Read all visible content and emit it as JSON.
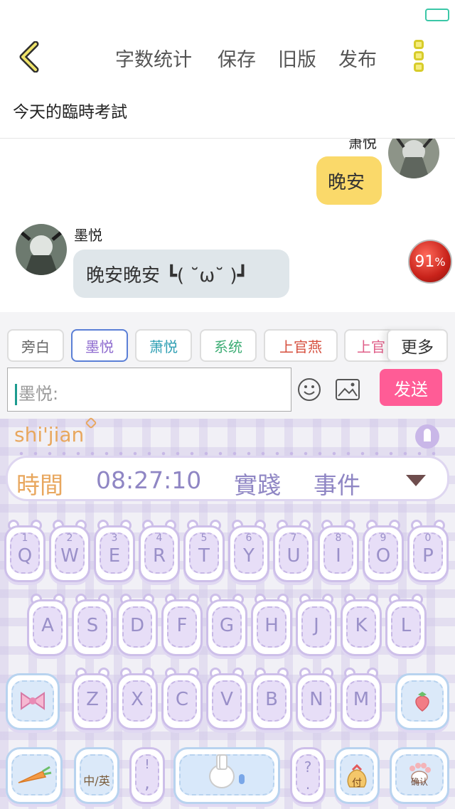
{
  "header": {
    "word_count": "字数统计",
    "save": "保存",
    "old_version": "旧版",
    "publish": "发布"
  },
  "document": {
    "title": "今天的臨時考試"
  },
  "chat": {
    "right_sender": "萧悦",
    "right_text": "晚安",
    "left_sender": "墨悦",
    "left_text": "晚安晚安 ┗( ˘ω˘ )┛",
    "badge_value": "91",
    "badge_unit": "%"
  },
  "roles": [
    "旁白",
    "墨悦",
    "萧悦",
    "系统",
    "上官燕",
    "上官"
  ],
  "role_more": "更多",
  "composer": {
    "prefix": "墨悦:",
    "send": "发送"
  },
  "keyboard": {
    "pinyin": "shi'jian",
    "candidates": [
      "時間",
      "08:27:10",
      "實踐",
      "事件"
    ],
    "row1": [
      {
        "num": "1",
        "letter": "Q"
      },
      {
        "num": "2",
        "letter": "W"
      },
      {
        "num": "3",
        "letter": "E"
      },
      {
        "num": "4",
        "letter": "R"
      },
      {
        "num": "5",
        "letter": "T"
      },
      {
        "num": "6",
        "letter": "Y"
      },
      {
        "num": "7",
        "letter": "U"
      },
      {
        "num": "8",
        "letter": "I"
      },
      {
        "num": "9",
        "letter": "O"
      },
      {
        "num": "0",
        "letter": "P"
      }
    ],
    "row2": [
      "A",
      "S",
      "D",
      "F",
      "G",
      "H",
      "J",
      "K",
      "L"
    ],
    "row3": [
      "Z",
      "X",
      "C",
      "V",
      "B",
      "N",
      "M"
    ],
    "lang_switch": "中/英",
    "punct": ",",
    "punct_top": "!",
    "question": "?",
    "question_bottom": ".",
    "pay": "付",
    "confirm": "确认"
  },
  "colors": {
    "send_button": "#ff5c96",
    "bubble_right": "#fad96a",
    "bubble_left": "#dfe6ea",
    "candidate_first": "#e8a75e",
    "key_letter": "#9a90c9"
  }
}
